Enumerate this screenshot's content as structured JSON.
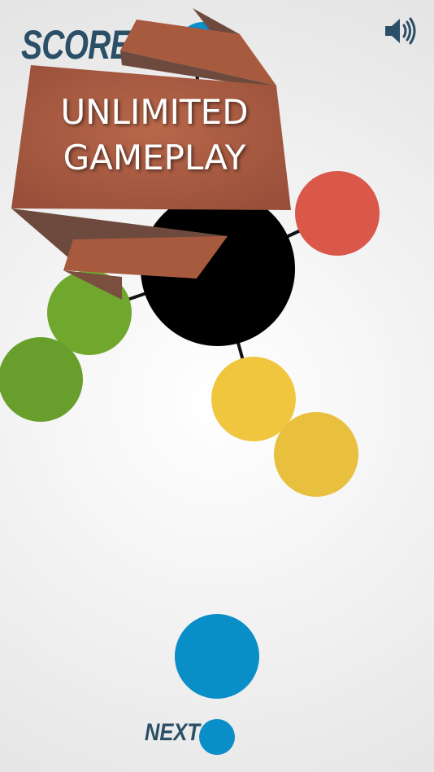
{
  "hud": {
    "score_label": "SCORE",
    "sound_icon": "speaker-volume-icon"
  },
  "banner": {
    "line1": "UNLIMITED",
    "line2": "GAMEPLAY"
  },
  "next": {
    "label": "NEXT",
    "ball_color": "#0a8ec8"
  },
  "colors": {
    "center": "#000000",
    "red": "#d9584a",
    "green": "#70a82e",
    "yellow": "#f0c63f",
    "blue": "#0a8ec8",
    "score_text": "#2b4f66",
    "ribbon_front": "#a85a3e",
    "ribbon_dark": "#6e4a3e"
  }
}
